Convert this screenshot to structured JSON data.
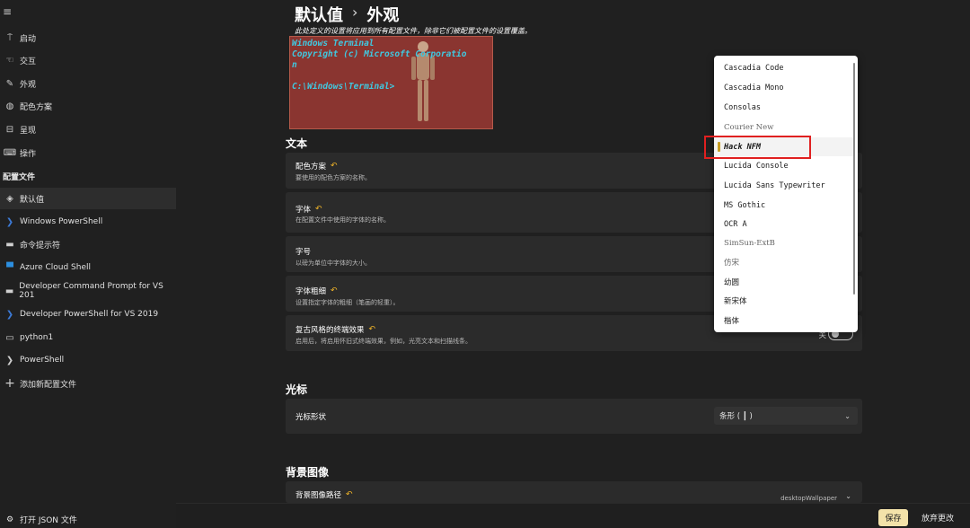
{
  "sidebar": {
    "menu_icon": "hamburger-icon",
    "items": [
      {
        "label": "启动",
        "icon": "startup-icon"
      },
      {
        "label": "交互",
        "icon": "interaction-icon"
      },
      {
        "label": "外观",
        "icon": "appearance-icon"
      },
      {
        "label": "配色方案",
        "icon": "palette-icon"
      },
      {
        "label": "呈现",
        "icon": "rendering-icon"
      },
      {
        "label": "操作",
        "icon": "keyboard-icon"
      }
    ],
    "profiles_header": "配置文件",
    "profiles": [
      {
        "label": "默认值",
        "icon": "layers-icon",
        "selected": true
      },
      {
        "label": "Windows PowerShell",
        "icon": "powershell-icon"
      },
      {
        "label": "命令提示符",
        "icon": "cmd-icon"
      },
      {
        "label": "Azure Cloud Shell",
        "icon": "azure-icon"
      },
      {
        "label": "Developer Command Prompt for VS 201",
        "icon": "cmd-icon"
      },
      {
        "label": "Developer PowerShell for VS 2019",
        "icon": "powershell-icon"
      },
      {
        "label": "python1",
        "icon": "terminal-icon"
      },
      {
        "label": "PowerShell",
        "icon": "powershell-icon"
      },
      {
        "label": "添加新配置文件",
        "icon": "plus-icon"
      }
    ],
    "open_json": "打开 JSON 文件"
  },
  "main": {
    "breadcrumb": {
      "parent": "默认值",
      "sep": "›",
      "current": "外观"
    },
    "notice": "此处定义的设置将应用到所有配置文件，除非它们被配置文件的设置覆盖。",
    "preview_text": "Windows Terminal\nCopyright (c) Microsoft Corporatio\nn\n\nC:\\Windows\\Terminal>",
    "sections": {
      "text": "文本",
      "cursor": "光标",
      "background": "背景图像"
    },
    "settings": {
      "color_scheme": {
        "title": "配色方案",
        "desc": "要使用的配色方案的名称。"
      },
      "font_face": {
        "title": "字体",
        "desc": "在配置文件中使用的字体的名称。"
      },
      "font_size": {
        "title": "字号",
        "desc": "以磅为单位中字体的大小。"
      },
      "font_weight": {
        "title": "字体粗细",
        "desc": "设置指定字体的粗细（笔画的轻重）。"
      },
      "retro": {
        "title": "复古风格的终端效果",
        "desc": "启用后，将启用怀旧式终端效果，例如，光亮文本和扫描线条。",
        "state": "关"
      },
      "cursor_shape": {
        "title": "光标形状",
        "value": "条形 ( ┃ )"
      },
      "bg_path": {
        "title": "背景图像路径",
        "value": "desktopWallpaper"
      }
    }
  },
  "font_dropdown": {
    "items": [
      {
        "label": "Cascadia Code",
        "style": "mono"
      },
      {
        "label": "Cascadia Mono",
        "style": "mono"
      },
      {
        "label": "Consolas",
        "style": "mono"
      },
      {
        "label": "Courier New",
        "style": "serif"
      },
      {
        "label": "Hack NFM",
        "style": "mono",
        "selected": true
      },
      {
        "label": "Lucida Console",
        "style": "mono"
      },
      {
        "label": "Lucida Sans Typewriter",
        "style": "mono"
      },
      {
        "label": "MS Gothic",
        "style": "mono"
      },
      {
        "label": "OCR A",
        "style": "mono"
      },
      {
        "label": "SimSun-ExtB",
        "style": "serif"
      },
      {
        "label": "仿宋",
        "style": "serif"
      },
      {
        "label": "幼圆",
        "style": "sans"
      },
      {
        "label": "新宋体",
        "style": "sans"
      },
      {
        "label": "楷体",
        "style": "sans"
      }
    ]
  },
  "footer": {
    "save": "保存",
    "discard": "放弃更改"
  },
  "colors": {
    "accent": "#c89e24",
    "highlight": "#e02020",
    "save_bg": "#f3e2a9"
  }
}
